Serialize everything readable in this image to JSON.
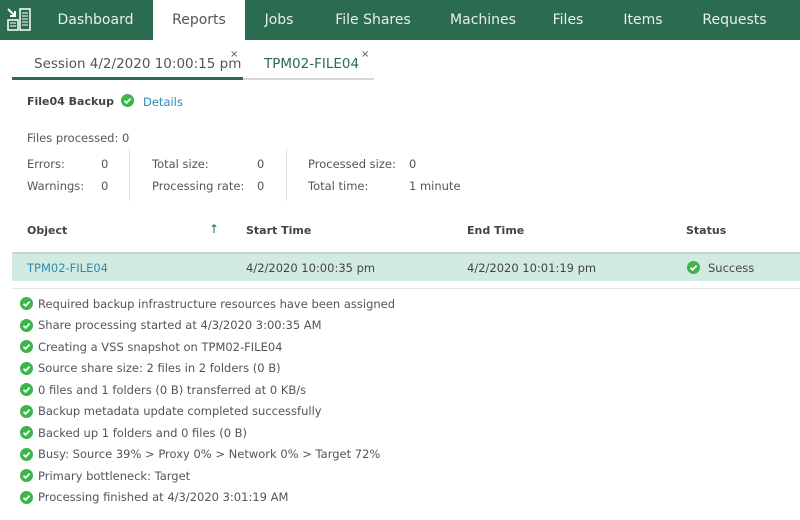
{
  "nav": {
    "items": [
      {
        "label": "Dashboard",
        "active": false
      },
      {
        "label": "Reports",
        "active": true
      },
      {
        "label": "Jobs",
        "active": false
      },
      {
        "label": "File Shares",
        "active": false
      },
      {
        "label": "Machines",
        "active": false
      },
      {
        "label": "Files",
        "active": false
      },
      {
        "label": "Items",
        "active": false
      },
      {
        "label": "Requests",
        "active": false
      }
    ]
  },
  "subtabs": [
    {
      "label": "Session 4/2/2020 10:00:15 pm",
      "close": "×",
      "active": true
    },
    {
      "label": "TPM02-FILE04",
      "close": "×",
      "active": false
    }
  ],
  "job": {
    "title": "File04 Backup",
    "status_icon": "check-circle-icon",
    "details_label": "Details"
  },
  "summary": {
    "files_processed": "Files processed: 0",
    "errors_label": "Errors:",
    "errors_value": "0",
    "warnings_label": "Warnings:",
    "warnings_value": "0",
    "total_size_label": "Total size:",
    "total_size_value": "0",
    "processing_rate_label": "Processing rate:",
    "processing_rate_value": "0",
    "processed_size_label": "Processed size:",
    "processed_size_value": "0",
    "total_time_label": "Total time:",
    "total_time_value": "1 minute"
  },
  "table": {
    "columns": [
      "Object",
      "Start Time",
      "End Time",
      "Status"
    ],
    "sort_icon": "arrow-up-icon",
    "rows": [
      {
        "object": "TPM02-FILE04",
        "start": "4/2/2020 10:00:35 pm",
        "end": "4/2/2020 10:01:19 pm",
        "status": "Success"
      }
    ]
  },
  "log": [
    "Required backup infrastructure resources have been assigned",
    "Share processing started at 4/3/2020 3:00:35 AM",
    "Creating a VSS snapshot on TPM02-FILE04",
    "Source share size: 2 files in 2 folders (0 B)",
    "0 files and 1 folders (0 B) transferred at 0 KB/s",
    "Backup metadata update completed successfully",
    "Backed up 1 folders and 0 files (0 B)",
    "Busy: Source 39% > Proxy 0% > Network 0% > Target 72%",
    "Primary bottleneck: Target",
    "Processing finished at 4/3/2020 3:01:19 AM"
  ],
  "colors": {
    "brand": "#2b6b4f",
    "success": "#3cb54a",
    "link": "#2a8ab8",
    "selected_row": "#d1ebe0"
  }
}
